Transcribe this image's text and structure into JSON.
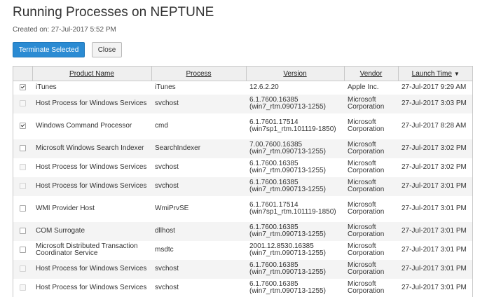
{
  "page": {
    "title": "Running Processes on NEPTUNE",
    "created": "Created on: 27-Jul-2017 5:52 PM"
  },
  "actions": {
    "terminate_label": "Terminate Selected",
    "close_label": "Close"
  },
  "table": {
    "columns": [
      "Product Name",
      "Process",
      "Version",
      "Vendor",
      "Launch Time"
    ],
    "sort_indicator": "▼",
    "rows": [
      {
        "product": "iTunes",
        "process": "iTunes",
        "version": "12.6.2.20",
        "vendor": "Apple Inc.",
        "launch": "27-Jul-2017 9:29 AM",
        "checked": true,
        "enabled": true
      },
      {
        "product": "Host Process for Windows Services",
        "process": "svchost",
        "version": "6.1.7600.16385 (win7_rtm.090713-1255)",
        "vendor": "Microsoft Corporation",
        "launch": "27-Jul-2017 3:03 PM",
        "checked": false,
        "enabled": false
      },
      {
        "product": "Windows Command Processor",
        "process": "cmd",
        "version": "6.1.7601.17514 (win7sp1_rtm.101119-1850)",
        "vendor": "Microsoft Corporation",
        "launch": "27-Jul-2017 8:28 AM",
        "checked": true,
        "enabled": true
      },
      {
        "product": "Microsoft Windows Search Indexer",
        "process": "SearchIndexer",
        "version": "7.00.7600.16385 (win7_rtm.090713-1255)",
        "vendor": "Microsoft Corporation",
        "launch": "27-Jul-2017 3:02 PM",
        "checked": false,
        "enabled": true
      },
      {
        "product": "Host Process for Windows Services",
        "process": "svchost",
        "version": "6.1.7600.16385 (win7_rtm.090713-1255)",
        "vendor": "Microsoft Corporation",
        "launch": "27-Jul-2017 3:02 PM",
        "checked": false,
        "enabled": false
      },
      {
        "product": "Host Process for Windows Services",
        "process": "svchost",
        "version": "6.1.7600.16385 (win7_rtm.090713-1255)",
        "vendor": "Microsoft Corporation",
        "launch": "27-Jul-2017 3:01 PM",
        "checked": false,
        "enabled": false
      },
      {
        "product": "WMI Provider Host",
        "process": "WmiPrvSE",
        "version": "6.1.7601.17514 (win7sp1_rtm.101119-1850)",
        "vendor": "Microsoft Corporation",
        "launch": "27-Jul-2017 3:01 PM",
        "checked": false,
        "enabled": true
      },
      {
        "product": "COM Surrogate",
        "process": "dllhost",
        "version": "6.1.7600.16385 (win7_rtm.090713-1255)",
        "vendor": "Microsoft Corporation",
        "launch": "27-Jul-2017 3:01 PM",
        "checked": false,
        "enabled": true
      },
      {
        "product": "Microsoft Distributed Transaction Coordinator Service",
        "process": "msdtc",
        "version": "2001.12.8530.16385 (win7_rtm.090713-1255)",
        "vendor": "Microsoft Corporation",
        "launch": "27-Jul-2017 3:01 PM",
        "checked": false,
        "enabled": true
      },
      {
        "product": "Host Process for Windows Services",
        "process": "svchost",
        "version": "6.1.7600.16385 (win7_rtm.090713-1255)",
        "vendor": "Microsoft Corporation",
        "launch": "27-Jul-2017 3:01 PM",
        "checked": false,
        "enabled": false
      },
      {
        "product": "Host Process for Windows Services",
        "process": "svchost",
        "version": "6.1.7600.16385 (win7_rtm.090713-1255)",
        "vendor": "Microsoft Corporation",
        "launch": "27-Jul-2017 3:01 PM",
        "checked": false,
        "enabled": false
      }
    ]
  },
  "colors": {
    "primary_button": "#2b8bd3",
    "header_bg": "#efefef",
    "alt_row_bg": "#f4f4f4"
  }
}
